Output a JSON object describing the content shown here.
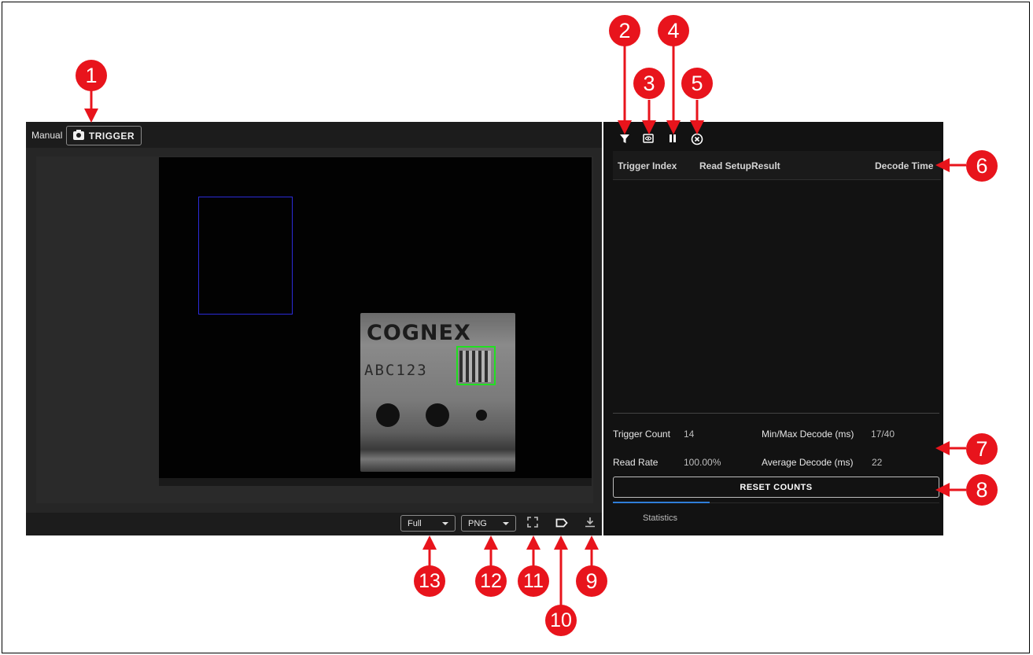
{
  "viewer": {
    "mode_label": "Manual",
    "trigger_label": "TRIGGER",
    "image": {
      "logo": "COGNEX",
      "code_text": "ABC123"
    },
    "toolbar": {
      "zoom_value": "Full",
      "format_value": "PNG"
    }
  },
  "results": {
    "toolbar_icons": [
      "filter-icon",
      "eye-icon",
      "pause-icon",
      "close-circle-icon"
    ],
    "columns": [
      "Trigger Index",
      "Read Setup",
      "Result",
      "Decode Time"
    ],
    "stats": {
      "trigger_count_label": "Trigger Count",
      "trigger_count_value": "14",
      "minmax_label": "Min/Max Decode (ms)",
      "minmax_value": "17/40",
      "read_rate_label": "Read Rate",
      "read_rate_value": "100.00%",
      "avg_label": "Average Decode (ms)",
      "avg_value": "22"
    },
    "reset_label": "RESET COUNTS",
    "tab_label": "Statistics"
  },
  "callouts": [
    "1",
    "2",
    "3",
    "4",
    "5",
    "6",
    "7",
    "8",
    "9",
    "10",
    "11",
    "12",
    "13"
  ],
  "colors": {
    "callout": "#e8141c",
    "roi_search": "#2b2bd8",
    "roi_code": "#22e022",
    "tab_accent": "#2f7ed8"
  }
}
